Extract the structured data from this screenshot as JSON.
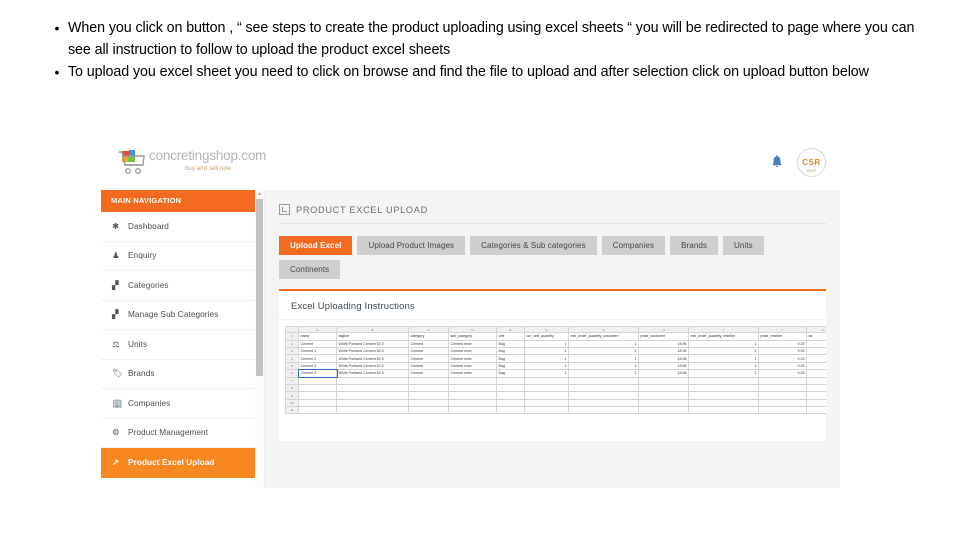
{
  "bullets": [
    "When you click on button , “ see steps to create the product uploading using excel sheets “ you will be redirected to page where you can see all instruction to follow to upload the product excel sheets",
    "To upload you excel sheet you need to click on browse and find the file to upload and after selection click on upload button below"
  ],
  "bullet_mark": "•",
  "screenshot": {
    "brand": {
      "name": "concretingshop.com",
      "tagline": "buy and sell now",
      "cart_icon": "shopping-cart-icon"
    },
    "header": {
      "bell_icon": "bell-icon",
      "avatar_letters": "CSR",
      "avatar_sub": "SHOP"
    },
    "sidebar": {
      "heading": "MAIN NAVIGATION",
      "items": [
        {
          "label": "Dashboard",
          "icon": "dashboard-icon",
          "glyph": "✱",
          "active": false
        },
        {
          "label": "Enquiry",
          "icon": "user-icon",
          "glyph": "♟",
          "active": false
        },
        {
          "label": "Categories",
          "icon": "grid-icon",
          "glyph": "▞",
          "active": false
        },
        {
          "label": "Manage Sub Categories",
          "icon": "grid-icon",
          "glyph": "▞",
          "active": false
        },
        {
          "label": "Units",
          "icon": "scale-icon",
          "glyph": "⚖",
          "active": false
        },
        {
          "label": "Brands",
          "icon": "tag-icon",
          "glyph": "🏷",
          "active": false
        },
        {
          "label": "Companies",
          "icon": "building-icon",
          "glyph": "🏢",
          "active": false
        },
        {
          "label": "Product Management",
          "icon": "cogs-icon",
          "glyph": "⚙",
          "active": false
        },
        {
          "label": "Product Excel Upload",
          "icon": "upload-icon",
          "glyph": "↗",
          "active": true
        }
      ],
      "scroll_up_glyph": "▲"
    },
    "page_title": "PRODUCT EXCEL UPLOAD",
    "tabs": [
      {
        "label": "Upload Excel",
        "active": true
      },
      {
        "label": "Upload Product Images",
        "active": false
      },
      {
        "label": "Categories & Sub categories",
        "active": false
      },
      {
        "label": "Companies",
        "active": false
      },
      {
        "label": "Brands",
        "active": false
      },
      {
        "label": "Units",
        "active": false
      },
      {
        "label": "Continents",
        "active": false
      }
    ],
    "panel_title": "Excel Uploading Instructions",
    "sheet": {
      "column_letters": [
        "",
        "A",
        "B",
        "C",
        "D",
        "E",
        "F",
        "G",
        "H",
        "I",
        "J",
        "K"
      ],
      "headers": [
        "name",
        "tagline",
        "category",
        "sub_category",
        "unit",
        "cur_unit_quantity",
        "min_order_quantity_customer",
        "price_customer",
        "min_order_quantity_reseller",
        "price_reseller",
        "va"
      ],
      "rows": [
        {
          "n": "2",
          "selected": false,
          "cells": [
            "Cement",
            "White Portland Cement 52.5",
            "Cement",
            "Cement mixe",
            "Bag",
            "1",
            "1",
            "18.96",
            "1",
            "9.25",
            ""
          ]
        },
        {
          "n": "3",
          "selected": false,
          "cells": [
            "Cement 1",
            "White Portland Cement 52.5",
            "Cement",
            "Cement mixe",
            "Bag",
            "1",
            "1",
            "18.96",
            "1",
            "9.25",
            ""
          ]
        },
        {
          "n": "4",
          "selected": false,
          "cells": [
            "Cement 2",
            "White Portland Cement 52.5",
            "Cement",
            "Cement mixe",
            "Bag",
            "1",
            "1",
            "18.96",
            "1",
            "9.25",
            ""
          ]
        },
        {
          "n": "5",
          "selected": false,
          "cells": [
            "Cement 3",
            "White Portland Cement 52.5",
            "Cement",
            "Cement mixe",
            "Bag",
            "1",
            "1",
            "18.96",
            "1",
            "9.25",
            ""
          ]
        },
        {
          "n": "6",
          "selected": true,
          "cells": [
            "Cement 4",
            "White Portland Cement 52.5",
            "Cement",
            "Cement mixe",
            "Bag",
            "1",
            "1",
            "18.96",
            "1",
            "9.25",
            ""
          ]
        }
      ],
      "empty_row_numbers": [
        "7",
        "8",
        "9",
        "10",
        "11"
      ],
      "header_row_number": "1"
    },
    "colors": {
      "accent_orange": "#f26b20",
      "active_nav_orange": "#f6881f",
      "tab_gray": "#cfcfcf",
      "content_bg": "#f4f4f4"
    }
  }
}
